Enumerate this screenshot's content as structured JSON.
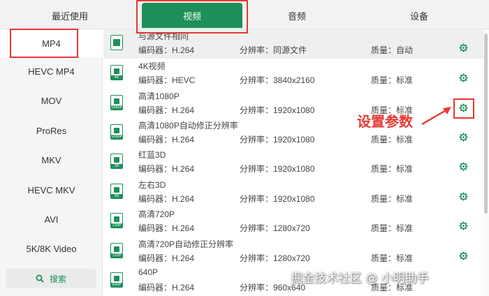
{
  "tabs": [
    "最近使用",
    "视频",
    "音频",
    "设备"
  ],
  "active_tab": "视频",
  "accent_color": "#1e8f5a",
  "annotation_color": "#e53935",
  "sidebar": {
    "items": [
      "MP4",
      "HEVC MP4",
      "MOV",
      "ProRes",
      "MKV",
      "HEVC MKV",
      "AVI",
      "5K/8K Video"
    ],
    "active": "MP4",
    "search_label": "搜索",
    "search_icon": "search-icon"
  },
  "formats": [
    {
      "name": "与源文件相同",
      "encoder": "编码器：H.264",
      "resolution": "分辨率：同源文件",
      "quality": "质量：自动",
      "icon_tag": ""
    },
    {
      "name": "4K视频",
      "encoder": "编码器：HEVC",
      "resolution": "分辨率：3840x2160",
      "quality": "质量：标准",
      "icon_tag": "4K"
    },
    {
      "name": "高清1080P",
      "encoder": "编码器：H.264",
      "resolution": "分辨率：1920x1080",
      "quality": "质量：标准",
      "icon_tag": "1080P"
    },
    {
      "name": "高清1080P自动修正分辨率",
      "encoder": "编码器：H.264",
      "resolution": "分辨率：1920x1080",
      "quality": "质量：标准",
      "icon_tag": "1080P"
    },
    {
      "name": "红蓝3D",
      "encoder": "编码器：H.264",
      "resolution": "分辨率：1920x1080",
      "quality": "质量：标准",
      "icon_tag": "3D"
    },
    {
      "name": "左右3D",
      "encoder": "编码器：H.264",
      "resolution": "分辨率：1920x1080",
      "quality": "质量：标准",
      "icon_tag": "3D"
    },
    {
      "name": "高清720P",
      "encoder": "编码器：H.264",
      "resolution": "分辨率：1280x720",
      "quality": "质量：标准",
      "icon_tag": "720P"
    },
    {
      "name": "高清720P自动修正分辨率",
      "encoder": "编码器：H.264",
      "resolution": "分辨率：1280x720",
      "quality": "质量：标准",
      "icon_tag": "720P"
    },
    {
      "name": "640P",
      "encoder": "编码器：H.264",
      "resolution": "分辨率：960x640",
      "quality": "质量：标准",
      "icon_tag": "640P"
    }
  ],
  "annotation": {
    "text": "设置参数"
  },
  "watermark": "掘金技术社区 @ 小明助手"
}
